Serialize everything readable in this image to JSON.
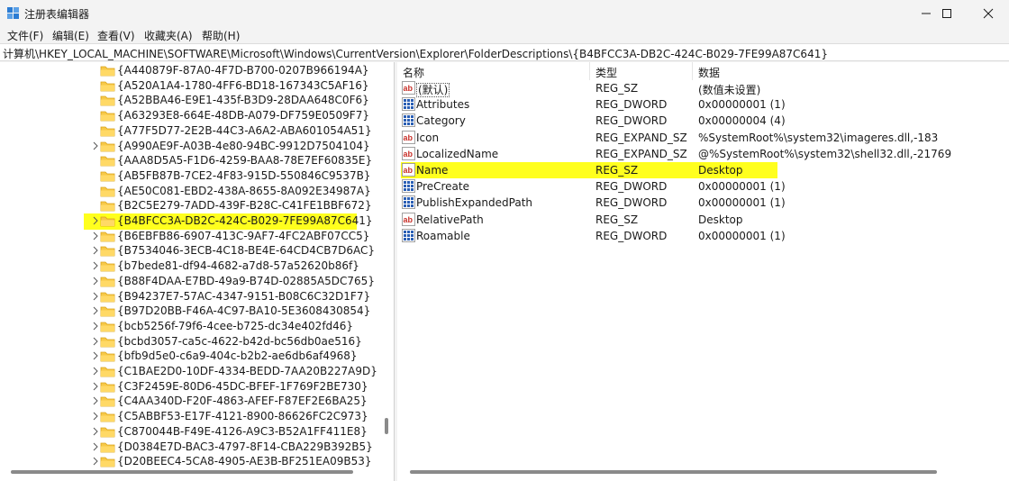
{
  "window": {
    "title": "注册表编辑器",
    "minimize_icon": "minimize-icon",
    "maximize_icon": "maximize-icon",
    "close_icon": "close-icon"
  },
  "menu": [
    "文件(F)",
    "编辑(E)",
    "查看(V)",
    "收藏夹(A)",
    "帮助(H)"
  ],
  "address": "计算机\\HKEY_LOCAL_MACHINE\\SOFTWARE\\Microsoft\\Windows\\CurrentVersion\\Explorer\\FolderDescriptions\\{B4BFCC3A-DB2C-424C-B029-7FE99A87C641}",
  "tree": {
    "items": [
      {
        "label": "{A440879F-87A0-4F7D-B700-0207B966194A}",
        "expandable": false,
        "selected": false
      },
      {
        "label": "{A520A1A4-1780-4FF6-BD18-167343C5AF16}",
        "expandable": false,
        "selected": false
      },
      {
        "label": "{A52BBA46-E9E1-435f-B3D9-28DAA648C0F6}",
        "expandable": false,
        "selected": false
      },
      {
        "label": "{A63293E8-664E-48DB-A079-DF759E0509F7}",
        "expandable": false,
        "selected": false
      },
      {
        "label": "{A77F5D77-2E2B-44C3-A6A2-ABA601054A51}",
        "expandable": false,
        "selected": false
      },
      {
        "label": "{A990AE9F-A03B-4e80-94BC-9912D7504104}",
        "expandable": true,
        "selected": false
      },
      {
        "label": "{AAA8D5A5-F1D6-4259-BAA8-78E7EF60835E}",
        "expandable": false,
        "selected": false
      },
      {
        "label": "{AB5FB87B-7CE2-4F83-915D-550846C9537B}",
        "expandable": false,
        "selected": false
      },
      {
        "label": "{AE50C081-EBD2-438A-8655-8A092E34987A}",
        "expandable": false,
        "selected": false
      },
      {
        "label": "{B2C5E279-7ADD-439F-B28C-C41FE1BBF672}",
        "expandable": false,
        "selected": false
      },
      {
        "label": "{B4BFCC3A-DB2C-424C-B029-7FE99A87C641}",
        "expandable": true,
        "selected": true
      },
      {
        "label": "{B6EBFB86-6907-413C-9AF7-4FC2ABF07CC5}",
        "expandable": true,
        "selected": false
      },
      {
        "label": "{B7534046-3ECB-4C18-BE4E-64CD4CB7D6AC}",
        "expandable": true,
        "selected": false
      },
      {
        "label": "{b7bede81-df94-4682-a7d8-57a52620b86f}",
        "expandable": true,
        "selected": false
      },
      {
        "label": "{B88F4DAA-E7BD-49a9-B74D-02885A5DC765}",
        "expandable": true,
        "selected": false
      },
      {
        "label": "{B94237E7-57AC-4347-9151-B08C6C32D1F7}",
        "expandable": true,
        "selected": false
      },
      {
        "label": "{B97D20BB-F46A-4C97-BA10-5E3608430854}",
        "expandable": true,
        "selected": false
      },
      {
        "label": "{bcb5256f-79f6-4cee-b725-dc34e402fd46}",
        "expandable": true,
        "selected": false
      },
      {
        "label": "{bcbd3057-ca5c-4622-b42d-bc56db0ae516}",
        "expandable": true,
        "selected": false
      },
      {
        "label": "{bfb9d5e0-c6a9-404c-b2b2-ae6db6af4968}",
        "expandable": true,
        "selected": false
      },
      {
        "label": "{C1BAE2D0-10DF-4334-BEDD-7AA20B227A9D}",
        "expandable": true,
        "selected": false
      },
      {
        "label": "{C3F2459E-80D6-45DC-BFEF-1F769F2BE730}",
        "expandable": true,
        "selected": false
      },
      {
        "label": "{C4AA340D-F20F-4863-AFEF-F87EF2E6BA25}",
        "expandable": true,
        "selected": false
      },
      {
        "label": "{C5ABBF53-E17F-4121-8900-86626FC2C973}",
        "expandable": true,
        "selected": false
      },
      {
        "label": "{C870044B-F49E-4126-A9C3-B52A1FF411E8}",
        "expandable": true,
        "selected": false
      },
      {
        "label": "{D0384E7D-BAC3-4797-8F14-CBA229B392B5}",
        "expandable": true,
        "selected": false
      },
      {
        "label": "{D20BEEC4-5CA8-4905-AE3B-BF251EA09B53}",
        "expandable": true,
        "selected": false
      }
    ]
  },
  "values": {
    "headers": {
      "name": "名称",
      "type": "类型",
      "data": "数据"
    },
    "rows": [
      {
        "icon": "string-value-icon",
        "name": "(默认)",
        "type": "REG_SZ",
        "data": "(数值未设置)",
        "is_default": true,
        "selected": false
      },
      {
        "icon": "binary-value-icon",
        "name": "Attributes",
        "type": "REG_DWORD",
        "data": "0x00000001 (1)",
        "is_default": false,
        "selected": false
      },
      {
        "icon": "binary-value-icon",
        "name": "Category",
        "type": "REG_DWORD",
        "data": "0x00000004 (4)",
        "is_default": false,
        "selected": false
      },
      {
        "icon": "string-value-icon",
        "name": "Icon",
        "type": "REG_EXPAND_SZ",
        "data": "%SystemRoot%\\system32\\imageres.dll,-183",
        "is_default": false,
        "selected": false
      },
      {
        "icon": "string-value-icon",
        "name": "LocalizedName",
        "type": "REG_EXPAND_SZ",
        "data": "@%SystemRoot%\\system32\\shell32.dll,-21769",
        "is_default": false,
        "selected": false
      },
      {
        "icon": "string-value-icon",
        "name": "Name",
        "type": "REG_SZ",
        "data": "Desktop",
        "is_default": false,
        "selected": true
      },
      {
        "icon": "binary-value-icon",
        "name": "PreCreate",
        "type": "REG_DWORD",
        "data": "0x00000001 (1)",
        "is_default": false,
        "selected": false
      },
      {
        "icon": "binary-value-icon",
        "name": "PublishExpandedPath",
        "type": "REG_DWORD",
        "data": "0x00000001 (1)",
        "is_default": false,
        "selected": false
      },
      {
        "icon": "string-value-icon",
        "name": "RelativePath",
        "type": "REG_SZ",
        "data": "Desktop",
        "is_default": false,
        "selected": false
      },
      {
        "icon": "binary-value-icon",
        "name": "Roamable",
        "type": "REG_DWORD",
        "data": "0x00000001 (1)",
        "is_default": false,
        "selected": false
      }
    ]
  },
  "colors": {
    "highlight": "#ffff1e",
    "folder": "#f7c948",
    "string_icon_red": "#c8322b",
    "binary_icon_blue": "#2b5fb4"
  }
}
